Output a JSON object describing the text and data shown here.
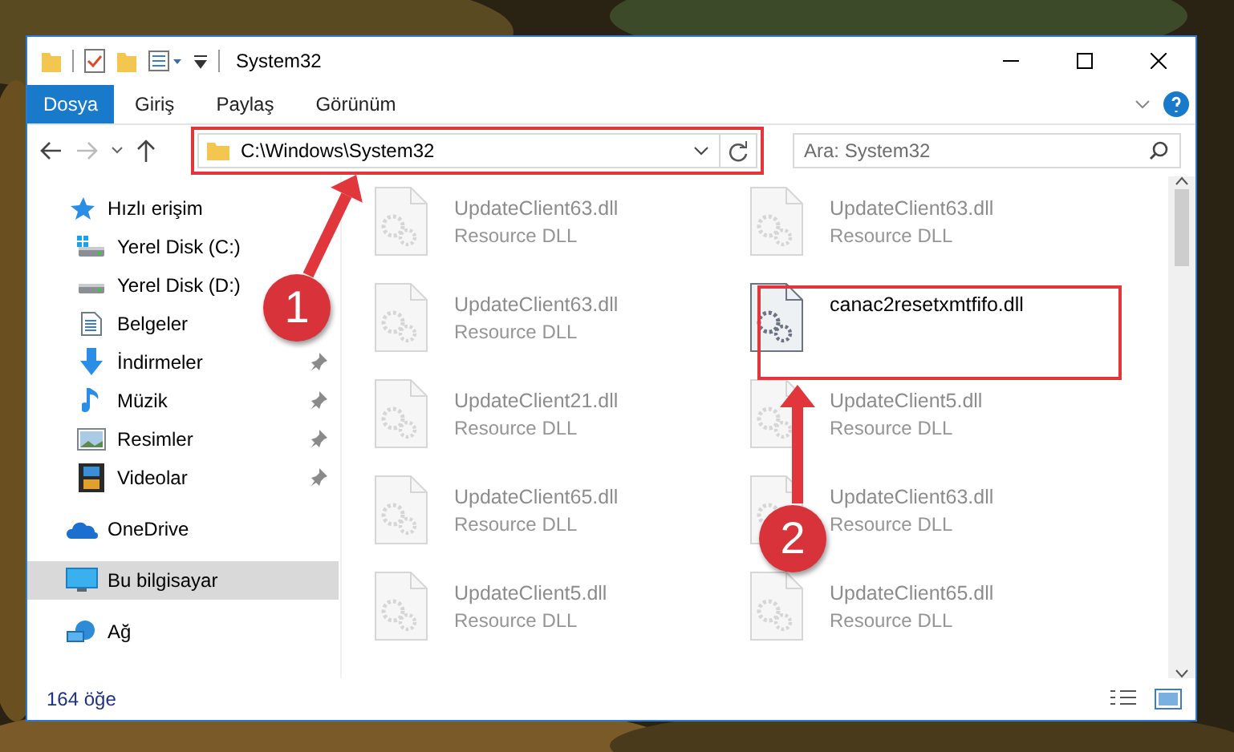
{
  "window": {
    "title": "System32"
  },
  "ribbon": {
    "tabs": [
      {
        "label": "Dosya",
        "selected": true
      },
      {
        "label": "Giriş",
        "selected": false
      },
      {
        "label": "Paylaş",
        "selected": false
      },
      {
        "label": "Görünüm",
        "selected": false
      }
    ]
  },
  "address_bar": {
    "path": "C:\\Windows\\System32"
  },
  "search": {
    "placeholder": "Ara: System32"
  },
  "sidebar": {
    "items": [
      {
        "label": "Hızlı erişim",
        "kind": "star",
        "selected": false,
        "children": [
          {
            "label": "Yerel Disk (C:)",
            "kind": "drive-c",
            "selected": false
          },
          {
            "label": "Yerel Disk (D:)",
            "kind": "drive",
            "selected": false
          },
          {
            "label": "Belgeler",
            "kind": "document",
            "selected": false
          },
          {
            "label": "İndirmeler",
            "kind": "download",
            "selected": false,
            "pinned": true
          },
          {
            "label": "Müzik",
            "kind": "music",
            "selected": false,
            "pinned": true
          },
          {
            "label": "Resimler",
            "kind": "pictures",
            "selected": false,
            "pinned": true
          },
          {
            "label": "Videolar",
            "kind": "video",
            "selected": false,
            "pinned": true
          }
        ]
      },
      {
        "label": "OneDrive",
        "kind": "cloud",
        "selected": false
      },
      {
        "label": "Bu bilgisayar",
        "kind": "computer",
        "selected": true
      },
      {
        "label": "Ağ",
        "kind": "network",
        "selected": false
      }
    ]
  },
  "files": [
    {
      "name": "UpdateClient63.dll",
      "type": "Resource DLL",
      "blurred": true
    },
    {
      "name": "UpdateClient63.dll",
      "type": "Resource DLL",
      "blurred": true
    },
    {
      "name": "UpdateClient63.dll",
      "type": "Resource DLL",
      "blurred": true
    },
    {
      "name": "canac2resetxmtfifo.dll",
      "blurred": false
    },
    {
      "name": "UpdateClient21.dll",
      "type": "Resource DLL",
      "blurred": true
    },
    {
      "name": "UpdateClient5.dll",
      "type": "Resource DLL",
      "blurred": true
    },
    {
      "name": "UpdateClient65.dll",
      "type": "Resource DLL",
      "blurred": true
    },
    {
      "name": "UpdateClient63.dll",
      "type": "Resource DLL",
      "blurred": true
    },
    {
      "name": "UpdateClient5.dll",
      "type": "Resource DLL",
      "blurred": true
    },
    {
      "name": "UpdateClient65.dll",
      "type": "Resource DLL",
      "blurred": true
    }
  ],
  "status_bar": {
    "count": "164 öğe"
  },
  "annotations": [
    {
      "number": "1"
    },
    {
      "number": "2"
    }
  ]
}
